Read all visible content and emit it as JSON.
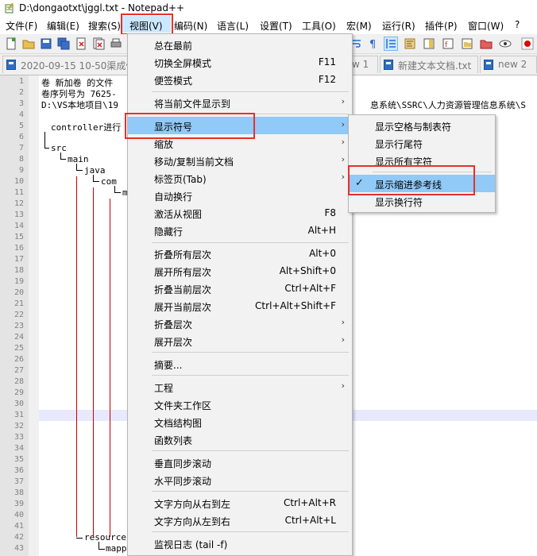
{
  "window": {
    "title": "D:\\dongaotxt\\jggl.txt - Notepad++"
  },
  "menubar": {
    "items": [
      "文件(F)",
      "编辑(E)",
      "搜索(S)",
      "视图(V)",
      "编码(N)",
      "语言(L)",
      "设置(T)",
      "工具(O)",
      "宏(M)",
      "运行(R)",
      "插件(P)",
      "窗口(W)",
      "?"
    ],
    "active": "视图(V)"
  },
  "tabs": [
    {
      "label": "2020-09-15 10-50渠成修"
    },
    {
      "label": "w 1"
    },
    {
      "label": "新建文本文档.txt"
    },
    {
      "label": "new 2"
    }
  ],
  "editor": {
    "line_numbers": [
      "1",
      "2",
      "3",
      "4",
      "5",
      "6",
      "7",
      "8",
      "9",
      "10",
      "11",
      "12",
      "13",
      "14",
      "15",
      "16",
      "17",
      "18",
      "19",
      "20",
      "21",
      "22",
      "23",
      "24",
      "25",
      "26",
      "27",
      "28",
      "29",
      "30",
      "31",
      "32",
      "33",
      "34",
      "35",
      "36",
      "37",
      "38",
      "39",
      "40",
      "41",
      "42",
      "43"
    ],
    "lines": {
      "l1": "卷 新加卷 的文件",
      "l2": "卷序列号为 7625-",
      "l3": "D:\\VS本地项目\\19",
      "l3b": "息系统\\SSRC\\人力资源管理信息系统\\S",
      "l5": "controller进行",
      "l7": "src",
      "l8": "main",
      "l9": "java",
      "l10": "com",
      "l11": "m",
      "l42": "resource",
      "l43": "mapp"
    }
  },
  "view_menu": {
    "items": [
      {
        "label": "总在最前",
        "shortcut": ""
      },
      {
        "label": "切换全屏模式",
        "shortcut": "F11"
      },
      {
        "label": "便签模式",
        "shortcut": "F12"
      },
      {
        "label": "将当前文件显示到",
        "shortcut": ""
      },
      {
        "label": "显示符号",
        "shortcut": ""
      },
      {
        "label": "缩放",
        "shortcut": ""
      },
      {
        "label": "移动/复制当前文档",
        "shortcut": ""
      },
      {
        "label": "标签页(Tab)",
        "shortcut": ""
      },
      {
        "label": "自动换行",
        "shortcut": ""
      },
      {
        "label": "激活从视图",
        "shortcut": "F8"
      },
      {
        "label": "隐藏行",
        "shortcut": "Alt+H"
      },
      {
        "label": "折叠所有层次",
        "shortcut": "Alt+0"
      },
      {
        "label": "展开所有层次",
        "shortcut": "Alt+Shift+0"
      },
      {
        "label": "折叠当前层次",
        "shortcut": "Ctrl+Alt+F"
      },
      {
        "label": "展开当前层次",
        "shortcut": "Ctrl+Alt+Shift+F"
      },
      {
        "label": "折叠层次",
        "shortcut": ""
      },
      {
        "label": "展开层次",
        "shortcut": ""
      },
      {
        "label": "摘要...",
        "shortcut": ""
      },
      {
        "label": "工程",
        "shortcut": ""
      },
      {
        "label": "文件夹工作区",
        "shortcut": ""
      },
      {
        "label": "文档结构图",
        "shortcut": ""
      },
      {
        "label": "函数列表",
        "shortcut": ""
      },
      {
        "label": "垂直同步滚动",
        "shortcut": ""
      },
      {
        "label": "水平同步滚动",
        "shortcut": ""
      },
      {
        "label": "文字方向从右到左",
        "shortcut": "Ctrl+Alt+R"
      },
      {
        "label": "文字方向从左到右",
        "shortcut": "Ctrl+Alt+L"
      },
      {
        "label": "监视日志 (tail -f)",
        "shortcut": ""
      }
    ]
  },
  "symbols_submenu": {
    "items": [
      {
        "label": "显示空格与制表符",
        "checked": false
      },
      {
        "label": "显示行尾符",
        "checked": false
      },
      {
        "label": "显示所有字符",
        "checked": false
      },
      {
        "label": "显示缩进参考线",
        "checked": true
      },
      {
        "label": "显示换行符",
        "checked": false
      }
    ]
  },
  "colors": {
    "highlight": "#91c9f7",
    "annotation": "#e8302a",
    "menu_bg": "#f2f2f2"
  }
}
